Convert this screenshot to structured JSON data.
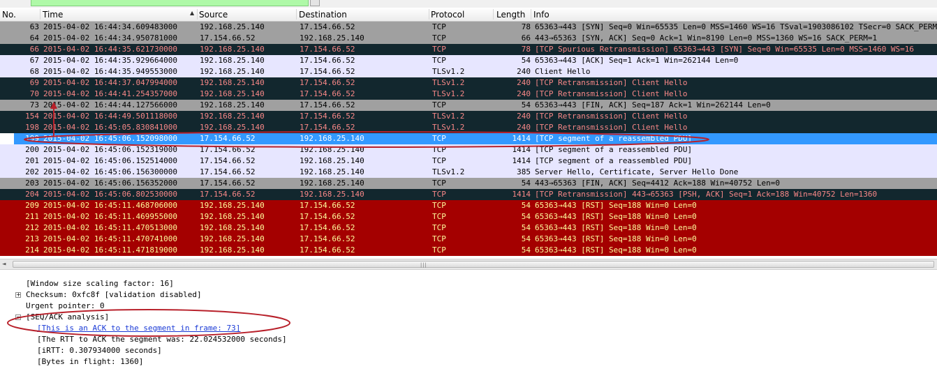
{
  "columns": {
    "no": "No.",
    "time": "Time",
    "source": "Source",
    "destination": "Destination",
    "protocol": "Protocol",
    "length": "Length",
    "info": "Info"
  },
  "packets": [
    {
      "no": "63",
      "time": "2015-04-02 16:44:34.609483000",
      "src": "192.168.25.140",
      "dst": "17.154.66.52",
      "proto": "TCP",
      "len": "78",
      "info": "65363→443 [SYN] Seq=0 Win=65535 Len=0 MSS=1460 WS=16 TSval=1903086102 TSecr=0 SACK_PERM=1",
      "style": "gray"
    },
    {
      "no": "64",
      "time": "2015-04-02 16:44:34.950781000",
      "src": "17.154.66.52",
      "dst": "192.168.25.140",
      "proto": "TCP",
      "len": "66",
      "info": "443→65363 [SYN, ACK] Seq=0 Ack=1 Win=8190 Len=0 MSS=1360 WS=16 SACK_PERM=1",
      "style": "gray"
    },
    {
      "no": "66",
      "time": "2015-04-02 16:44:35.621730000",
      "src": "192.168.25.140",
      "dst": "17.154.66.52",
      "proto": "TCP",
      "len": "78",
      "info": "[TCP Spurious Retransmission] 65363→443 [SYN] Seq=0 Win=65535 Len=0 MSS=1460 WS=16",
      "style": "dark"
    },
    {
      "no": "67",
      "time": "2015-04-02 16:44:35.929664000",
      "src": "192.168.25.140",
      "dst": "17.154.66.52",
      "proto": "TCP",
      "len": "54",
      "info": "65363→443 [ACK] Seq=1 Ack=1 Win=262144 Len=0",
      "style": "lav"
    },
    {
      "no": "68",
      "time": "2015-04-02 16:44:35.949553000",
      "src": "192.168.25.140",
      "dst": "17.154.66.52",
      "proto": "TLSv1.2",
      "len": "240",
      "info": "Client Hello",
      "style": "lav"
    },
    {
      "no": "69",
      "time": "2015-04-02 16:44:37.047994000",
      "src": "192.168.25.140",
      "dst": "17.154.66.52",
      "proto": "TLSv1.2",
      "len": "240",
      "info": "[TCP Retransmission] Client Hello",
      "style": "dark"
    },
    {
      "no": "70",
      "time": "2015-04-02 16:44:41.254357000",
      "src": "192.168.25.140",
      "dst": "17.154.66.52",
      "proto": "TLSv1.2",
      "len": "240",
      "info": "[TCP Retransmission] Client Hello",
      "style": "dark"
    },
    {
      "no": "73",
      "time": "2015-04-02 16:44:44.127566000",
      "src": "192.168.25.140",
      "dst": "17.154.66.52",
      "proto": "TCP",
      "len": "54",
      "info": "65363→443 [FIN, ACK] Seq=187 Ack=1 Win=262144 Len=0",
      "style": "gray"
    },
    {
      "no": "154",
      "time": "2015-04-02 16:44:49.501118000",
      "src": "192.168.25.140",
      "dst": "17.154.66.52",
      "proto": "TLSv1.2",
      "len": "240",
      "info": "[TCP Retransmission] Client Hello",
      "style": "dark"
    },
    {
      "no": "198",
      "time": "2015-04-02 16:45:05.830841000",
      "src": "192.168.25.140",
      "dst": "17.154.66.52",
      "proto": "TLSv1.2",
      "len": "240",
      "info": "[TCP Retransmission] Client Hello",
      "style": "dark"
    },
    {
      "no": "199",
      "time": "2015-04-02 16:45:06.152098000",
      "src": "17.154.66.52",
      "dst": "192.168.25.140",
      "proto": "TCP",
      "len": "1414",
      "info": "[TCP segment of a reassembled PDU]",
      "style": "sel"
    },
    {
      "no": "200",
      "time": "2015-04-02 16:45:06.152319000",
      "src": "17.154.66.52",
      "dst": "192.168.25.140",
      "proto": "TCP",
      "len": "1414",
      "info": "[TCP segment of a reassembled PDU]",
      "style": "lav"
    },
    {
      "no": "201",
      "time": "2015-04-02 16:45:06.152514000",
      "src": "17.154.66.52",
      "dst": "192.168.25.140",
      "proto": "TCP",
      "len": "1414",
      "info": "[TCP segment of a reassembled PDU]",
      "style": "lav"
    },
    {
      "no": "202",
      "time": "2015-04-02 16:45:06.156300000",
      "src": "17.154.66.52",
      "dst": "192.168.25.140",
      "proto": "TLSv1.2",
      "len": "385",
      "info": "Server Hello, Certificate, Server Hello Done",
      "style": "lav"
    },
    {
      "no": "203",
      "time": "2015-04-02 16:45:06.156352000",
      "src": "17.154.66.52",
      "dst": "192.168.25.140",
      "proto": "TCP",
      "len": "54",
      "info": "443→65363 [FIN, ACK] Seq=4412 Ack=188 Win=40752 Len=0",
      "style": "gray"
    },
    {
      "no": "204",
      "time": "2015-04-02 16:45:06.802530000",
      "src": "17.154.66.52",
      "dst": "192.168.25.140",
      "proto": "TCP",
      "len": "1414",
      "info": "[TCP Retransmission] 443→65363 [PSH, ACK] Seq=1 Ack=188 Win=40752 Len=1360",
      "style": "dark"
    },
    {
      "no": "209",
      "time": "2015-04-02 16:45:11.468706000",
      "src": "192.168.25.140",
      "dst": "17.154.66.52",
      "proto": "TCP",
      "len": "54",
      "info": "65363→443 [RST] Seq=188 Win=0 Len=0",
      "style": "red"
    },
    {
      "no": "211",
      "time": "2015-04-02 16:45:11.469955000",
      "src": "192.168.25.140",
      "dst": "17.154.66.52",
      "proto": "TCP",
      "len": "54",
      "info": "65363→443 [RST] Seq=188 Win=0 Len=0",
      "style": "red"
    },
    {
      "no": "212",
      "time": "2015-04-02 16:45:11.470513000",
      "src": "192.168.25.140",
      "dst": "17.154.66.52",
      "proto": "TCP",
      "len": "54",
      "info": "65363→443 [RST] Seq=188 Win=0 Len=0",
      "style": "red"
    },
    {
      "no": "213",
      "time": "2015-04-02 16:45:11.470741000",
      "src": "192.168.25.140",
      "dst": "17.154.66.52",
      "proto": "TCP",
      "len": "54",
      "info": "65363→443 [RST] Seq=188 Win=0 Len=0",
      "style": "red"
    },
    {
      "no": "214",
      "time": "2015-04-02 16:45:11.471819000",
      "src": "192.168.25.140",
      "dst": "17.154.66.52",
      "proto": "TCP",
      "len": "54",
      "info": "65363→443 [RST] Seq=188 Win=0 Len=0",
      "style": "red"
    }
  ],
  "details": {
    "window_scaling": "[Window size scaling factor: 16]",
    "checksum": "Checksum: 0xfc8f [validation disabled]",
    "checksum_expander": "+",
    "urgent": "Urgent pointer: 0",
    "seqack": "[SEQ/ACK analysis]",
    "seqack_expander": "−",
    "ack_frame_link": "[This is an ACK to the segment in frame: 73]",
    "rtt": "[The RTT to ACK the segment was: 22.024532000 seconds]",
    "irtt": "[iRTT: 0.307934000 seconds]",
    "bytes_in_flight": "[Bytes in flight: 1360]"
  },
  "icons": {
    "sort": "▲",
    "scroll_left": "◄",
    "scroll_grip": "|||"
  },
  "colors": {
    "annotation": "#b8202a",
    "selected_row": "#3399ff",
    "filter_valid": "#aff9a8"
  }
}
